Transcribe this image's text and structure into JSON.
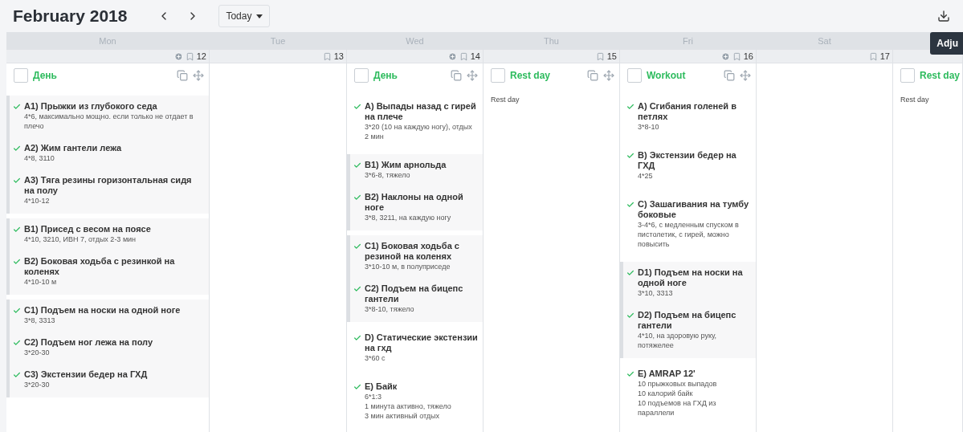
{
  "header": {
    "title": "February 2018",
    "today_button": "Today",
    "tooltip": "Adju"
  },
  "days": [
    {
      "weekday": "Mon",
      "date": "12",
      "add_icon": true,
      "workout": {
        "title": "День",
        "checked": false,
        "groups": [
          {
            "superset": true,
            "exercises": [
              {
                "name": "А1) Прыжки из глубокого седа",
                "details": [
                  "4*6, максимально мощно. если только не отдает в плечо"
                ],
                "done": true
              },
              {
                "name": "А2) Жим гантели лежа",
                "details": [
                  "4*8, 3110"
                ],
                "done": true
              },
              {
                "name": "А3) Тяга резины горизонтальная сидя на полу",
                "details": [
                  "4*10-12"
                ],
                "done": true
              }
            ]
          },
          {
            "superset": true,
            "exercises": [
              {
                "name": "В1) Присед с весом на поясе",
                "details": [
                  "4*10, 3210, ИВН 7, отдых 2-3 мин"
                ],
                "done": true
              },
              {
                "name": "В2) Боковая ходьба с резинкой на коленях",
                "details": [
                  "4*10-10 м"
                ],
                "done": true
              }
            ]
          },
          {
            "superset": true,
            "exercises": [
              {
                "name": "С1) Подъем на носки на одной ноге",
                "details": [
                  "3*8, 3313"
                ],
                "done": true
              },
              {
                "name": "С2) Подъем ног лежа на полу",
                "details": [
                  "3*20-30"
                ],
                "done": true
              },
              {
                "name": "С3) Экстензии бедер на ГХД",
                "details": [
                  "3*20-30"
                ],
                "done": true
              }
            ]
          }
        ]
      }
    },
    {
      "weekday": "Tue",
      "date": "13",
      "add_icon": false
    },
    {
      "weekday": "Wed",
      "date": "14",
      "add_icon": true,
      "workout": {
        "title": "День",
        "checked": false,
        "groups": [
          {
            "superset": false,
            "exercises": [
              {
                "name": "A) Выпады назад с гирей на плече",
                "details": [
                  "3*20 (10 на каждую ногу), отдых 2 мин"
                ],
                "done": true
              }
            ]
          },
          {
            "superset": true,
            "exercises": [
              {
                "name": "B1) Жим арнольда",
                "details": [
                  "3*6-8, тяжело"
                ],
                "done": true
              },
              {
                "name": "B2) Наклоны на одной ноге",
                "details": [
                  "3*8, 3211, на каждую ногу"
                ],
                "done": true
              }
            ]
          },
          {
            "superset": true,
            "exercises": [
              {
                "name": "C1) Боковая ходьба с резиной на коленях",
                "details": [
                  "3*10-10 м, в полуприседе"
                ],
                "done": true
              },
              {
                "name": "C2) Подъем на бицепс гантели",
                "details": [
                  "3*8-10, тяжело"
                ],
                "done": true
              }
            ]
          },
          {
            "superset": false,
            "exercises": [
              {
                "name": "D) Статические экстензии на гхд",
                "details": [
                  "3*60 с"
                ],
                "done": true
              }
            ]
          },
          {
            "superset": false,
            "exercises": [
              {
                "name": "E) Байк",
                "details": [
                  "6*1:3",
                  "1 минута активно, тяжело",
                  "3 мин активный отдых"
                ],
                "done": true
              }
            ]
          }
        ]
      }
    },
    {
      "weekday": "Thu",
      "date": "15",
      "add_icon": false,
      "workout": {
        "title": "Rest day",
        "checked": false,
        "note": "Rest day"
      }
    },
    {
      "weekday": "Fri",
      "date": "16",
      "add_icon": true,
      "workout": {
        "title": "Workout",
        "checked": false,
        "groups": [
          {
            "superset": false,
            "exercises": [
              {
                "name": "A) Сгибания голеней в петлях",
                "details": [
                  "3*8-10"
                ],
                "done": true
              }
            ]
          },
          {
            "superset": false,
            "exercises": [
              {
                "name": "B) Экстензии бедер на ГХД",
                "details": [
                  "4*25"
                ],
                "done": true
              }
            ]
          },
          {
            "superset": false,
            "exercises": [
              {
                "name": "C) Зашагивания на тумбу боковые",
                "details": [
                  "3-4*6, с медленным спуском в пистолетик, с гирей, можно повысить"
                ],
                "done": true
              }
            ]
          },
          {
            "superset": true,
            "exercises": [
              {
                "name": "D1) Подъем на носки на одной ноге",
                "details": [
                  "3*10, 3313"
                ],
                "done": true
              },
              {
                "name": "D2) Подъем на бицепс гантели",
                "details": [
                  "4*10, на здоровую руку, потяжелее"
                ],
                "done": true
              }
            ]
          },
          {
            "superset": false,
            "exercises": [
              {
                "name": "E) AMRAP 12'",
                "details": [
                  "10 прыжковых выпадов",
                  "10 калорий байк",
                  "10 подъемов на ГХД из параллели"
                ],
                "done": true
              }
            ]
          }
        ]
      }
    },
    {
      "weekday": "Sat",
      "date": "17",
      "add_icon": false
    },
    {
      "workout": {
        "title": "Rest day",
        "checked": false,
        "note": "Rest day"
      }
    }
  ]
}
